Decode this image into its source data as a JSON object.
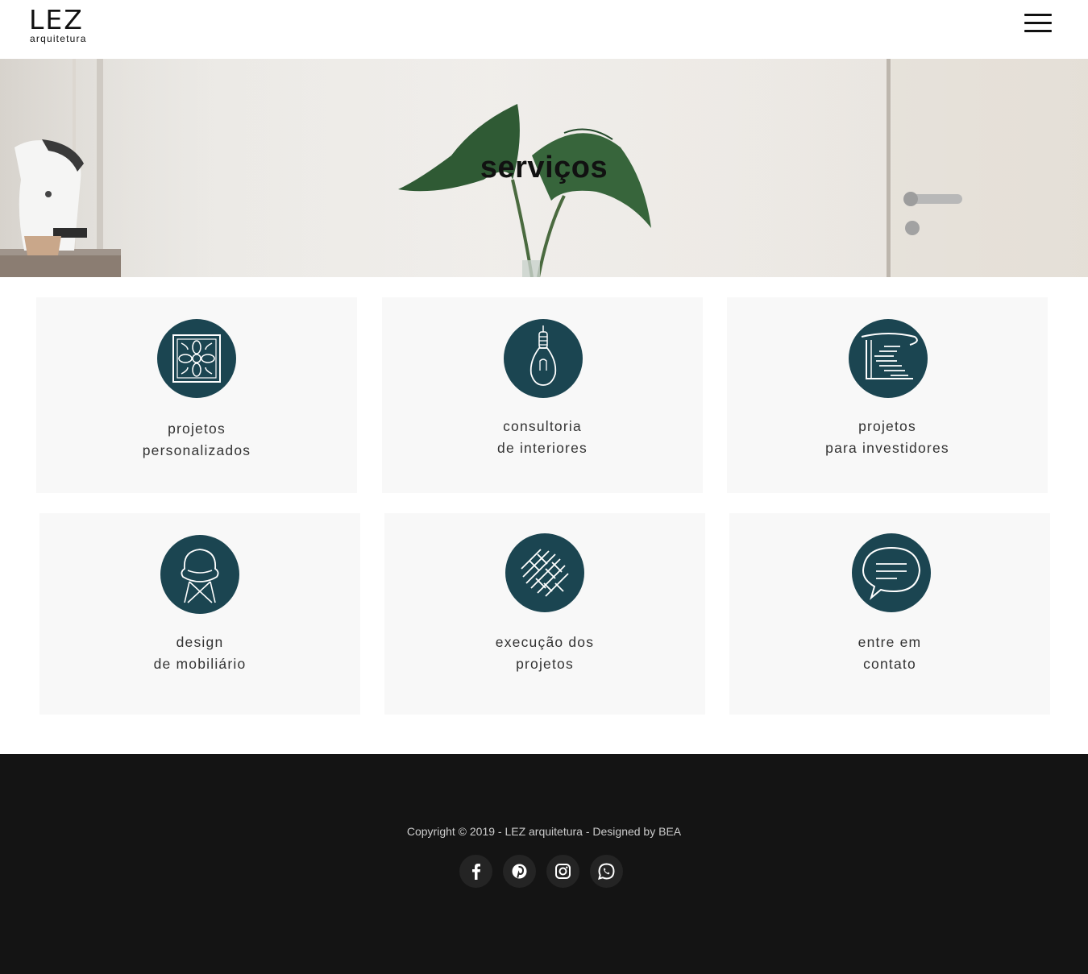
{
  "header": {
    "logo_mark": "LEZ",
    "logo_sub": "arquitetura",
    "menu_icon": "hamburger-menu-icon"
  },
  "hero": {
    "title": "serviços"
  },
  "services": [
    {
      "line1": "projetos",
      "line2": "personalizados",
      "icon": "ornament-tile-icon"
    },
    {
      "line1": "consultoria",
      "line2": "de interiores",
      "icon": "light-bulb-icon"
    },
    {
      "line1": "projetos",
      "line2": "para investidores",
      "icon": "staircase-icon"
    },
    {
      "line1": "design",
      "line2": "de mobiliário",
      "icon": "chair-icon"
    },
    {
      "line1": "execução dos",
      "line2": "projetos",
      "icon": "herringbone-floor-icon"
    },
    {
      "line1": "entre em",
      "line2": "contato",
      "icon": "chat-bubble-icon"
    }
  ],
  "footer": {
    "copyright": "Copyright © 2019 - LEZ arquitetura - Designed by BEA",
    "socials": [
      "facebook-icon",
      "pinterest-icon",
      "instagram-icon",
      "whatsapp-icon"
    ]
  },
  "colors": {
    "icon_circle": "#1b4551",
    "card_background": "#f8f8f8",
    "footer_background": "#141414"
  }
}
